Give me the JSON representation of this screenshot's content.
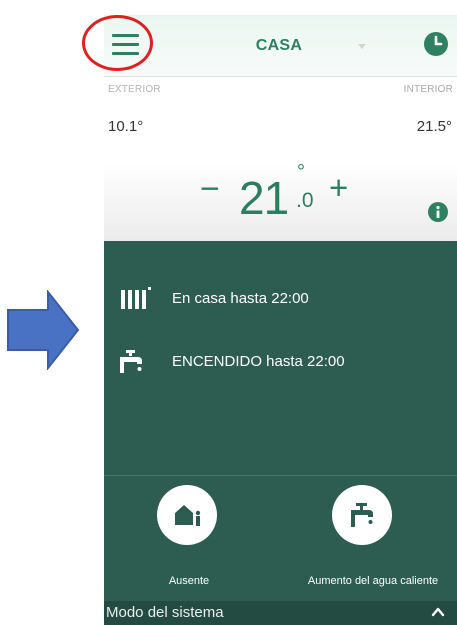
{
  "header": {
    "title": "CASA"
  },
  "temperatures": {
    "exterior_label": "EXTERIOR",
    "exterior_value": "10.1°",
    "interior_label": "INTERIOR",
    "interior_value": "21.5°"
  },
  "setpoint": {
    "minus": "−",
    "integer": "21",
    "degree": "°",
    "decimal": ".0",
    "plus": "+"
  },
  "status": [
    {
      "icon": "radiator-icon",
      "text": "En casa hasta 22:00"
    },
    {
      "icon": "faucet-icon",
      "text": "ENCENDIDO hasta 22:00"
    }
  ],
  "actions": [
    {
      "icon": "away-house-person-icon",
      "label": "Ausente"
    },
    {
      "icon": "faucet-icon",
      "label": "Aumento del agua caliente"
    }
  ],
  "footer": {
    "label": "Modo del sistema"
  },
  "annotations": {
    "highlight": "red-circle",
    "pointer": "blue-arrow"
  },
  "colors": {
    "accent": "#2d7e60",
    "panel": "#2d5c50",
    "footer": "#234b41",
    "highlight": "#e02020",
    "arrow": "#4a72c4"
  }
}
